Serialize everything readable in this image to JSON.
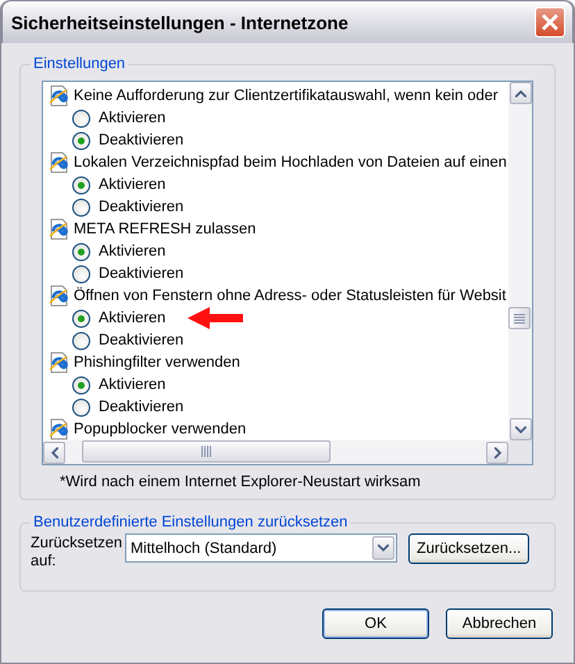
{
  "window": {
    "title": "Sicherheitseinstellungen - Internetzone"
  },
  "settings_group": {
    "title": "Einstellungen",
    "settings": [
      {
        "label": "Keine Aufforderung zur Clientzertifikatauswahl, wenn kein oder",
        "options": [
          {
            "label": "Aktivieren",
            "selected": false,
            "highlighted": false
          },
          {
            "label": "Deaktivieren",
            "selected": true,
            "highlighted": false
          }
        ]
      },
      {
        "label": "Lokalen Verzeichnispfad beim Hochladen von Dateien auf einen",
        "options": [
          {
            "label": "Aktivieren",
            "selected": true,
            "highlighted": false
          },
          {
            "label": "Deaktivieren",
            "selected": false,
            "highlighted": false
          }
        ]
      },
      {
        "label": "META REFRESH zulassen",
        "options": [
          {
            "label": "Aktivieren",
            "selected": true,
            "highlighted": false
          },
          {
            "label": "Deaktivieren",
            "selected": false,
            "highlighted": false
          }
        ]
      },
      {
        "label": "Öffnen von Fenstern ohne Adress- oder Statusleisten für Websit",
        "options": [
          {
            "label": "Aktivieren",
            "selected": true,
            "highlighted": true
          },
          {
            "label": "Deaktivieren",
            "selected": false,
            "highlighted": false
          }
        ]
      },
      {
        "label": "Phishingfilter verwenden",
        "options": [
          {
            "label": "Aktivieren",
            "selected": true,
            "highlighted": false
          },
          {
            "label": "Deaktivieren",
            "selected": false,
            "highlighted": false
          }
        ]
      },
      {
        "label": "Popupblocker verwenden"
      }
    ],
    "note": "*Wird nach einem Internet Explorer-Neustart wirksam"
  },
  "reset_group": {
    "title": "Benutzerdefinierte Einstellungen zurücksetzen",
    "label": "Zurücksetzen auf:",
    "value": "Mittelhoch (Standard)",
    "button": "Zurücksetzen..."
  },
  "buttons": [
    "OK",
    "Abbrechen"
  ]
}
